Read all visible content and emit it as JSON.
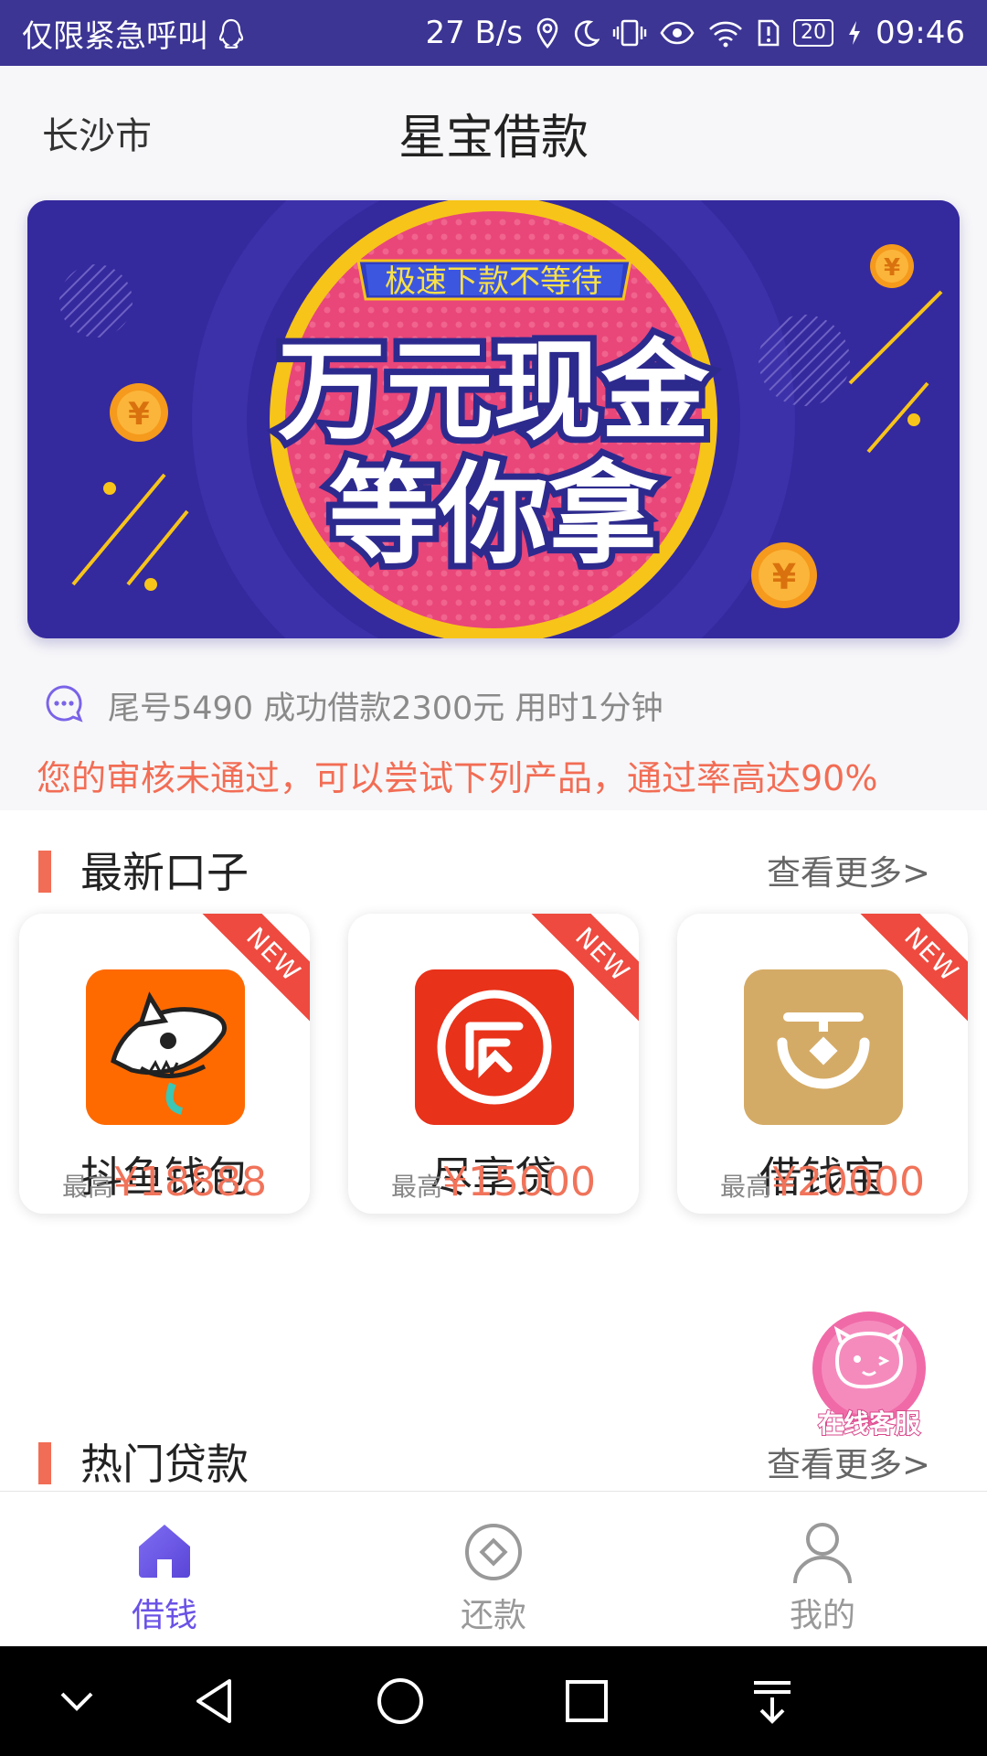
{
  "status_bar": {
    "carrier": "仅限紧急呼叫",
    "speed": "27 B/s",
    "battery": "20",
    "time": "09:46"
  },
  "header": {
    "city": "长沙市",
    "title": "星宝借款"
  },
  "banner": {
    "tagline": "极速下款不等待",
    "line1": "万元现金",
    "line2": "等你拿"
  },
  "notice": {
    "text": "尾号5490 成功借款2300元 用时1分钟"
  },
  "warning": "您的审核未通过，可以尝试下列产品，通过率高达90%",
  "latest": {
    "title": "最新口子",
    "more": "查看更多>",
    "badge": "NEW",
    "items": [
      {
        "name": "抖鱼钱包",
        "prefix": "最高",
        "amount": "¥18888",
        "color": "#ff6a00"
      },
      {
        "name": "尽享贷",
        "prefix": "最高",
        "amount": "¥15000",
        "color": "#e8321a"
      },
      {
        "name": "借钱宝",
        "prefix": "最高",
        "amount": "¥20000",
        "color": "#d4ab66"
      }
    ]
  },
  "hot": {
    "title": "热门贷款",
    "more": "查看更多>"
  },
  "service": {
    "label": "在线客服"
  },
  "tabs": [
    {
      "label": "借钱",
      "icon": "home-icon",
      "active": true
    },
    {
      "label": "还款",
      "icon": "repay-icon",
      "active": false
    },
    {
      "label": "我的",
      "icon": "profile-icon",
      "active": false
    }
  ],
  "colors": {
    "brand": "#6a52e6",
    "status_bar": "#3c3594",
    "accent": "#f26d55"
  }
}
